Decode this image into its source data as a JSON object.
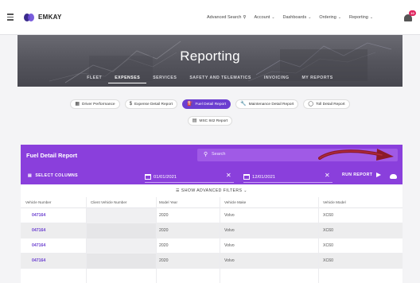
{
  "app": {
    "brand": "EMKAY",
    "nav": [
      {
        "label": "Advanced Search",
        "icon": "search-icon"
      },
      {
        "label": "Account",
        "icon": "chevron-down-icon"
      },
      {
        "label": "Dashboards",
        "icon": "chevron-down-icon"
      },
      {
        "label": "Ordering",
        "icon": "chevron-down-icon"
      },
      {
        "label": "Reporting",
        "icon": "chevron-down-icon"
      }
    ],
    "notification_count": "10"
  },
  "hero": {
    "title": "Reporting",
    "tabs": [
      "FLEET",
      "EXPENSES",
      "SERVICES",
      "SAFETY AND TELEMATICS",
      "INVOICING",
      "MY REPORTS"
    ],
    "active_tab": "EXPENSES"
  },
  "reports": {
    "row1": [
      {
        "label": "Driver Performance",
        "icon": "id-card-icon"
      },
      {
        "label": "Expense Detail Report",
        "icon": "dollar-icon"
      },
      {
        "label": "Fuel Detail Report",
        "icon": "fuel-pump-icon",
        "active": true
      },
      {
        "label": "Maintenance Detail Report",
        "icon": "wrench-icon"
      },
      {
        "label": "Toll Detail Report",
        "icon": "toll-icon"
      }
    ],
    "row2": [
      {
        "label": "MSC 842 Report",
        "icon": "document-icon"
      }
    ]
  },
  "panel": {
    "title": "Fuel Detail Report",
    "search_placeholder": "Search",
    "select_columns": "SELECT COLUMNS",
    "start_date": "01/01/2021",
    "end_date": "12/01/2021",
    "run_report": "RUN REPORT",
    "advanced_filters": "SHOW ADVANCED FILTERS",
    "accent_color": "#8a3fdc"
  },
  "table": {
    "columns": [
      "Vehicle Number",
      "Client Vehicle Number",
      "Model Year",
      "Vehicle Make",
      "Vehicle Model"
    ],
    "rows": [
      [
        "047164",
        "",
        "2020",
        "Volvo",
        "XC60"
      ],
      [
        "047164",
        "",
        "2020",
        "Volvo",
        "XC60"
      ],
      [
        "047164",
        "",
        "2020",
        "Volvo",
        "XC60"
      ],
      [
        "047164",
        "",
        "2020",
        "Volvo",
        "XC60"
      ]
    ]
  }
}
